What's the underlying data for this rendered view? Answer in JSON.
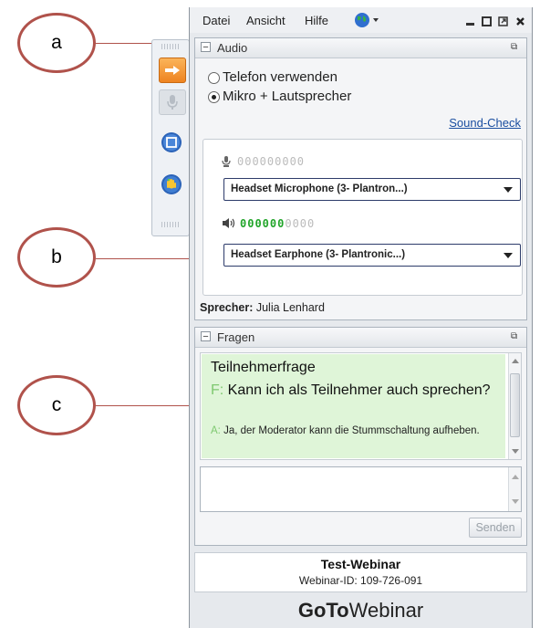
{
  "callouts": {
    "a": "a",
    "b": "b",
    "c": "c"
  },
  "menu": {
    "file": "Datei",
    "view": "Ansicht",
    "help": "Hilfe"
  },
  "audio": {
    "title": "Audio",
    "option_phone": "Telefon verwenden",
    "option_mic": "Mikro + Lautsprecher",
    "sound_check": "Sound-Check",
    "mic_level": {
      "lit": "",
      "unlit": "000000000",
      "value": 0
    },
    "microphone_device": "Headset Microphone (3- Plantron...)",
    "speaker_level": {
      "lit": "000000",
      "unlit": "0000",
      "value": 0.6
    },
    "speaker_device": "Headset Earphone (3- Plantronic...)",
    "speaker_label": "Sprecher:",
    "speaker_name": "Julia Lenhard"
  },
  "questions": {
    "title": "Fragen",
    "heading": "Teilnehmerfrage",
    "q_prefix": "F:",
    "q_text": "Kann ich als Teilnehmer auch sprechen?",
    "a_prefix": "A:",
    "a_text": "Ja, der Moderator kann die Stummschaltung aufheben.",
    "input_value": "",
    "send": "Senden"
  },
  "webinar": {
    "name": "Test-Webinar",
    "id_line": "Webinar-ID: 109-726-091"
  },
  "brand": {
    "bold": "GoTo",
    "light": "Webinar"
  },
  "icons": [
    "arrow-right-icon",
    "microphone-icon",
    "stop-screen-icon",
    "raise-hand-icon",
    "globe-icon",
    "minimize-icon",
    "maximize-icon",
    "undock-icon",
    "close-icon",
    "speaker-icon",
    "dropdown-arrow-icon"
  ],
  "colors": {
    "accent_link": "#1a4ea0",
    "highlight": "#dff5d8",
    "prefix": "#7ec86f",
    "level_on": "#22a52a",
    "callout": "#b0524b",
    "orange": "#f29a34"
  }
}
